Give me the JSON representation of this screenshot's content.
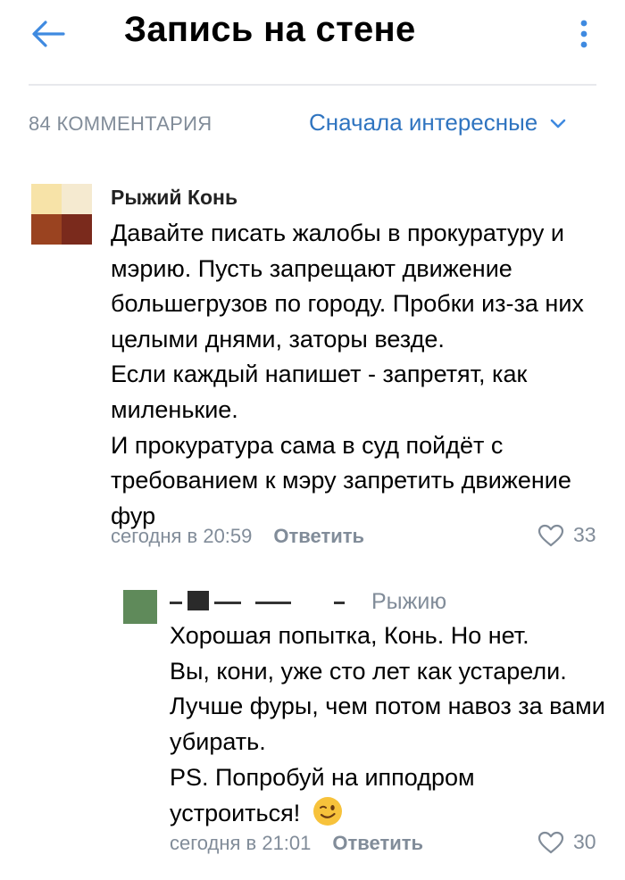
{
  "header": {
    "title": "Запись на стене",
    "back_icon": "arrow-left-icon",
    "more_icon": "more-vertical-icon",
    "accent": "#3f8ae0"
  },
  "comments_bar": {
    "count": "84 КОММЕНТАРИЯ",
    "sort": "Сначала интересные",
    "sort_icon": "chevron-down-icon"
  },
  "comments": [
    {
      "author": "Рыжий Конь",
      "text_paragraphs": [
        "Давайте писать жалобы в прокуратуру и мэрию. Пусть запрещают движение большегрузов по городу. Пробки из-за них целыми днями, заторы везде.",
        "Если каждый напишет - запретят, как миленькие.",
        "И прокуратура сама в суд пойдёт с требованием к мэру запретить движение фур"
      ],
      "time": "сегодня в 20:59",
      "reply": "Ответить",
      "likes": "33",
      "avatar_colors": [
        "#f7e3a8",
        "#f5ead0",
        "#9a4320",
        "#7a2a1c"
      ]
    }
  ],
  "reply": {
    "reply_to": "Рыжию",
    "text_paragraphs": [
      "Хорошая попытка, Конь. Но нет.",
      "Вы, кони, уже сто лет как устарели.",
      "Лучше фуры, чем потом навоз за вами убирать.",
      "PS.  Попробуй на ипподром устроиться!"
    ],
    "emoji": "winking-face-icon",
    "time": "сегодня в 21:01",
    "reply": "Ответить",
    "likes": "30",
    "avatar_color": "#5f8a5a"
  }
}
